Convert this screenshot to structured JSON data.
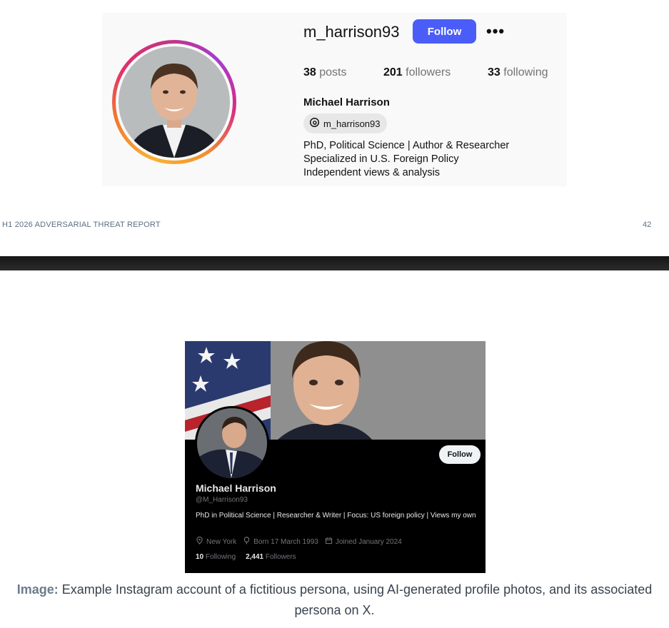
{
  "instagram": {
    "username": "m_harrison93",
    "follow_label": "Follow",
    "more_label": "•••",
    "stats": {
      "posts_count": "38",
      "posts_label": "posts",
      "followers_count": "201",
      "followers_label": "followers",
      "following_count": "33",
      "following_label": "following"
    },
    "display_name": "Michael Harrison",
    "threads_handle": "m_harrison93",
    "bio": [
      "PhD, Political Science | Author & Researcher",
      "Specialized in U.S. Foreign Policy",
      "Independent views & analysis"
    ]
  },
  "report": {
    "footer_title": "H1 2026 ADVERSARIAL THREAT  REPORT",
    "page_number": "42"
  },
  "x_profile": {
    "follow_label": "Follow",
    "display_name": "Michael Harrison",
    "handle": "@M_Harrison93",
    "bio": "PhD in Political Science | Researcher & Writer | Focus: US foreign policy | Views my own",
    "location": "New York",
    "born": "Born 17 March 1993",
    "joined": "Joined January 2024",
    "following_count": "10",
    "following_label": "Following",
    "followers_count": "2,441",
    "followers_label": "Followers"
  },
  "caption": {
    "label": "Image:",
    "text": "Example Instagram account of a fictitious persona, using AI-generated profile photos, and its associated persona on X."
  },
  "colors": {
    "instagram_follow": "#4a5df9",
    "caption_label": "#6b7c8c",
    "footer_text": "#5b6f82"
  }
}
